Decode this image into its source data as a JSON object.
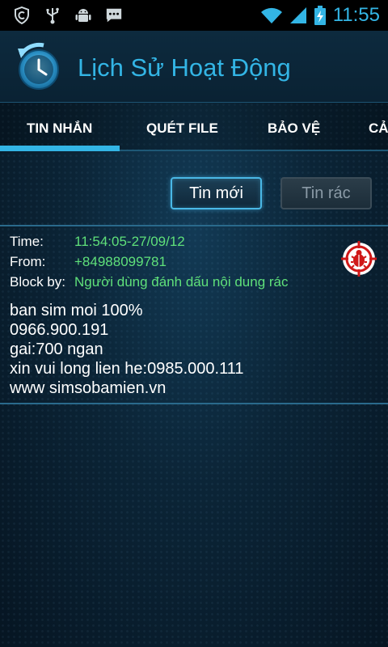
{
  "status_bar": {
    "time": "11:55",
    "left_icons": [
      "shield-icon",
      "usb-icon",
      "android-debug-icon",
      "chat-icon"
    ],
    "right_icons": [
      "wifi-icon",
      "signal-icon",
      "battery-charging-icon"
    ]
  },
  "header": {
    "title": "Lịch Sử Hoạt Động",
    "logo_icon": "history-clock-icon"
  },
  "tabs": [
    {
      "label": "TIN NHẮN",
      "active": true
    },
    {
      "label": "QUÉT FILE",
      "active": false
    },
    {
      "label": "BẢO VỆ",
      "active": false
    },
    {
      "label": "CẢ",
      "active": false
    }
  ],
  "filter_buttons": {
    "new_label": "Tin mới",
    "spam_label": "Tin rác"
  },
  "message": {
    "time_label": "Time:",
    "time_value": "11:54:05-27/09/12",
    "from_label": "From:",
    "from_value": "+84988099781",
    "block_label": "Block by:",
    "block_value": "Người dùng đánh dấu nội dung rác",
    "body_lines": [
      "ban sim moi 100%",
      "0966.900.191",
      "gai:700 ngan",
      "xin vui long lien he:0985.000.111",
      "www simsobamien.vn"
    ],
    "action_icon": "spam-bug-icon"
  },
  "colors": {
    "accent": "#33b5e5",
    "meta_value": "#5fe07a",
    "background": "#0b2436"
  }
}
